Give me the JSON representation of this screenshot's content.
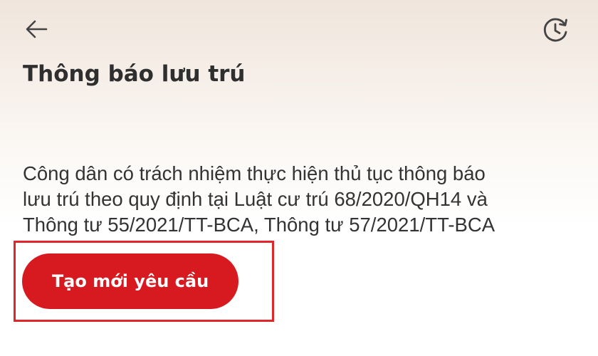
{
  "header": {
    "back_icon": "arrow-left-icon",
    "history_icon": "history-clock-icon",
    "title": "Thông báo lưu trú"
  },
  "description": {
    "lines": [
      "Công dân có trách nhiệm thực hiện thủ tục thông báo",
      "lưu trú theo quy định tại Luật cư trú 68/2020/QH14 và",
      "Thông tư 55/2021/TT-BCA, Thông tư 57/2021/TT-BCA"
    ]
  },
  "actions": {
    "create_label": "Tạo mới yêu cầu"
  },
  "colors": {
    "accent": "#d71920",
    "highlight": "#e0262b",
    "text": "#2f2f2f"
  }
}
